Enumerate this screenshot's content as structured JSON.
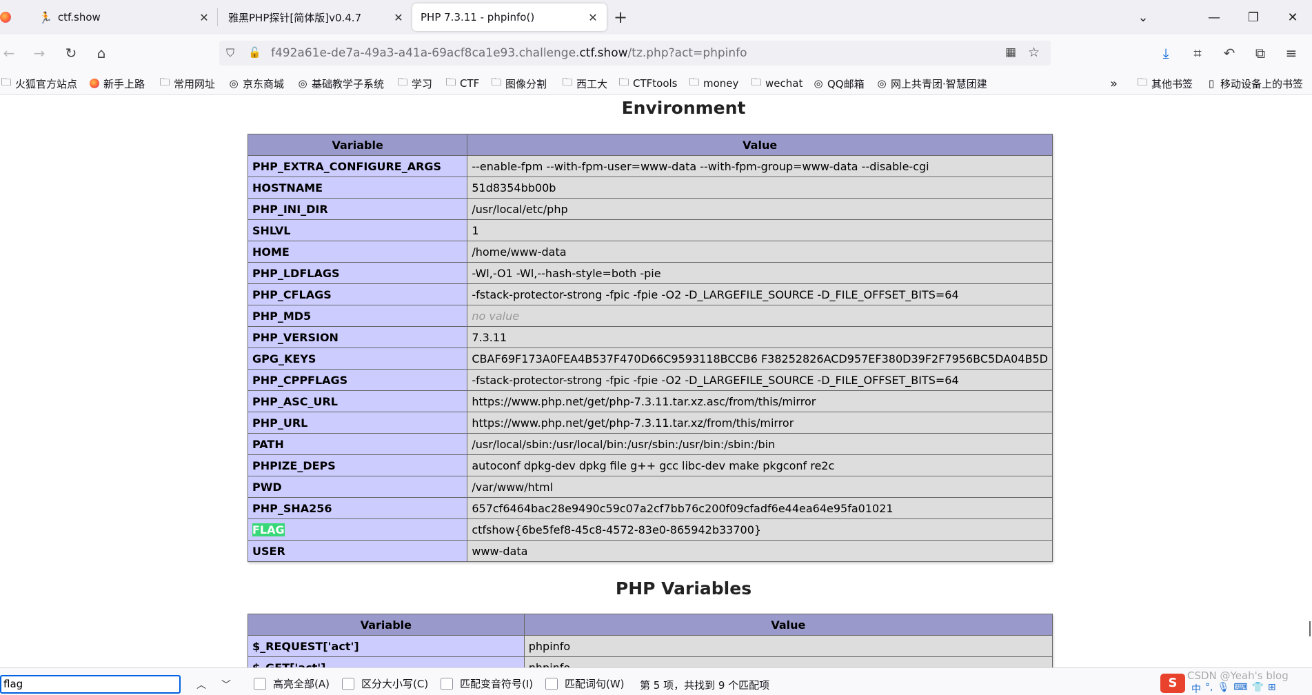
{
  "tabs": [
    {
      "title": "ctf.show",
      "active": false
    },
    {
      "title": "雅黑PHP探针[简体版]v0.4.7",
      "active": false
    },
    {
      "title": "PHP 7.3.11 - phpinfo()",
      "active": true
    }
  ],
  "url": {
    "prefix": "f492a61e-de7a-49a3-a41a-69acf8ca1e93.challenge.",
    "host": "ctf.show",
    "path": "/tz.php?act=phpinfo"
  },
  "bookmarks": [
    {
      "label": "火狐官方站点",
      "icon": "folder-icon"
    },
    {
      "label": "新手上路",
      "icon": "firefox-icon"
    },
    {
      "label": "常用网址",
      "icon": "folder-icon"
    },
    {
      "label": "京东商城",
      "icon": "globe-icon"
    },
    {
      "label": "基础教学子系统",
      "icon": "globe-icon"
    },
    {
      "label": "学习",
      "icon": "folder-icon"
    },
    {
      "label": "CTF",
      "icon": "folder-icon"
    },
    {
      "label": "图像分割",
      "icon": "folder-icon"
    },
    {
      "label": "西工大",
      "icon": "folder-icon"
    },
    {
      "label": "CTFtools",
      "icon": "folder-icon"
    },
    {
      "label": "money",
      "icon": "folder-icon"
    },
    {
      "label": "wechat",
      "icon": "folder-icon"
    },
    {
      "label": "QQ邮箱",
      "icon": "globe-icon"
    },
    {
      "label": "网上共青团·智慧团建",
      "icon": "globe-icon"
    }
  ],
  "bookmarks_right": [
    {
      "label": "其他书签",
      "icon": "folder-icon"
    },
    {
      "label": "移动设备上的书签",
      "icon": "mobile-icon"
    }
  ],
  "environment": {
    "title": "Environment",
    "headers": [
      "Variable",
      "Value"
    ],
    "rows": [
      {
        "name": "PHP_EXTRA_CONFIGURE_ARGS",
        "value": "--enable-fpm --with-fpm-user=www-data --with-fpm-group=www-data --disable-cgi"
      },
      {
        "name": "HOSTNAME",
        "value": "51d8354bb00b"
      },
      {
        "name": "PHP_INI_DIR",
        "value": "/usr/local/etc/php"
      },
      {
        "name": "SHLVL",
        "value": "1"
      },
      {
        "name": "HOME",
        "value": "/home/www-data"
      },
      {
        "name": "PHP_LDFLAGS",
        "value": "-Wl,-O1 -Wl,--hash-style=both -pie"
      },
      {
        "name": "PHP_CFLAGS",
        "value": "-fstack-protector-strong -fpic -fpie -O2 -D_LARGEFILE_SOURCE -D_FILE_OFFSET_BITS=64"
      },
      {
        "name": "PHP_MD5",
        "value": "no value",
        "novalue": true
      },
      {
        "name": "PHP_VERSION",
        "value": "7.3.11"
      },
      {
        "name": "GPG_KEYS",
        "value": "CBAF69F173A0FEA4B537F470D66C9593118BCCB6 F38252826ACD957EF380D39F2F7956BC5DA04B5D"
      },
      {
        "name": "PHP_CPPFLAGS",
        "value": "-fstack-protector-strong -fpic -fpie -O2 -D_LARGEFILE_SOURCE -D_FILE_OFFSET_BITS=64"
      },
      {
        "name": "PHP_ASC_URL",
        "value": "https://www.php.net/get/php-7.3.11.tar.xz.asc/from/this/mirror"
      },
      {
        "name": "PHP_URL",
        "value": "https://www.php.net/get/php-7.3.11.tar.xz/from/this/mirror"
      },
      {
        "name": "PATH",
        "value": "/usr/local/sbin:/usr/local/bin:/usr/sbin:/usr/bin:/sbin:/bin"
      },
      {
        "name": "PHPIZE_DEPS",
        "value": "autoconf dpkg-dev dpkg file g++ gcc libc-dev make pkgconf re2c"
      },
      {
        "name": "PWD",
        "value": "/var/www/html"
      },
      {
        "name": "PHP_SHA256",
        "value": "657cf6464bac28e9490c59c07a2cf7bb76c200f09cfadf6e44ea64e95fa01021"
      },
      {
        "name": "FLAG",
        "value": "ctfshow{6be5fef8-45c8-4572-83e0-865942b33700}",
        "highlight": true
      },
      {
        "name": "USER",
        "value": "www-data"
      }
    ]
  },
  "php_variables": {
    "title": "PHP Variables",
    "headers": [
      "Variable",
      "Value"
    ],
    "rows": [
      {
        "name": "$_REQUEST['act']",
        "value": "phpinfo"
      },
      {
        "name": "$_GET['act']",
        "value": "phpinfo"
      }
    ]
  },
  "findbar": {
    "query": "flag",
    "options": [
      "高亮全部(A)",
      "区分大小写(C)",
      "匹配变音符号(I)",
      "匹配词句(W)"
    ],
    "status": "第 5 项，共找到 9 个匹配项"
  },
  "watermark": "CSDN @Yeah's blog",
  "colors": {
    "accent": "#0061e0",
    "table_header": "#9999cc",
    "table_key": "#ccccff",
    "table_value": "#dddddd",
    "find_highlight": "#38d878"
  }
}
